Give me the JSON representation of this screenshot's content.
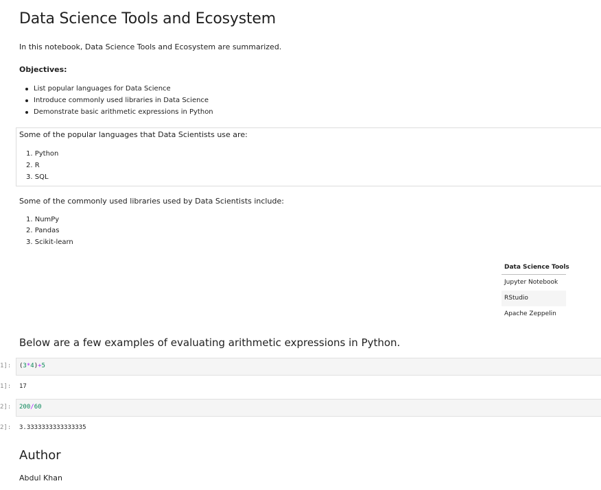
{
  "title": "Data Science Tools and Ecosystem",
  "intro": "In this notebook, Data Science Tools and Ecosystem are summarized.",
  "objectives": {
    "heading": "Objectives:",
    "items": [
      "List popular languages for Data Science",
      "Introduce commonly used libraries in Data Science",
      "Demonstrate basic arithmetic expressions in Python"
    ]
  },
  "languages": {
    "intro": "Some of the popular languages that Data Scientists use are:",
    "items": [
      "1. Python",
      "2. R",
      "3. SQL"
    ]
  },
  "libraries": {
    "intro": "Some of the commonly used libraries used by Data Scientists include:",
    "items": [
      "1. NumPy",
      "2. Pandas",
      "3. Scikit-learn"
    ]
  },
  "tools_table": {
    "header": "Data Science Tools",
    "rows": [
      "Jupyter Notebook",
      "RStudio",
      "Apache Zeppelin"
    ],
    "stripe_color": "#f5f5f5"
  },
  "examples_heading": "Below are a few examples of evaluating arithmetic expressions in Python.",
  "cells": [
    {
      "in_prompt": "1]:",
      "code_tokens": [
        "(",
        "3",
        "*",
        "4",
        ")",
        "+",
        "5"
      ],
      "out_prompt": "1]:",
      "output": "17"
    },
    {
      "in_prompt": "2]:",
      "code_tokens": [
        "200",
        "/",
        "60"
      ],
      "out_prompt": "2]:",
      "output": "3.3333333333333335"
    }
  ],
  "colors": {
    "number": "#098658",
    "operator": "#aa22ff",
    "prompt": "#8a8a8a",
    "code_bg": "#f5f5f5"
  },
  "author": {
    "heading": "Author",
    "name": "Abdul Khan"
  }
}
